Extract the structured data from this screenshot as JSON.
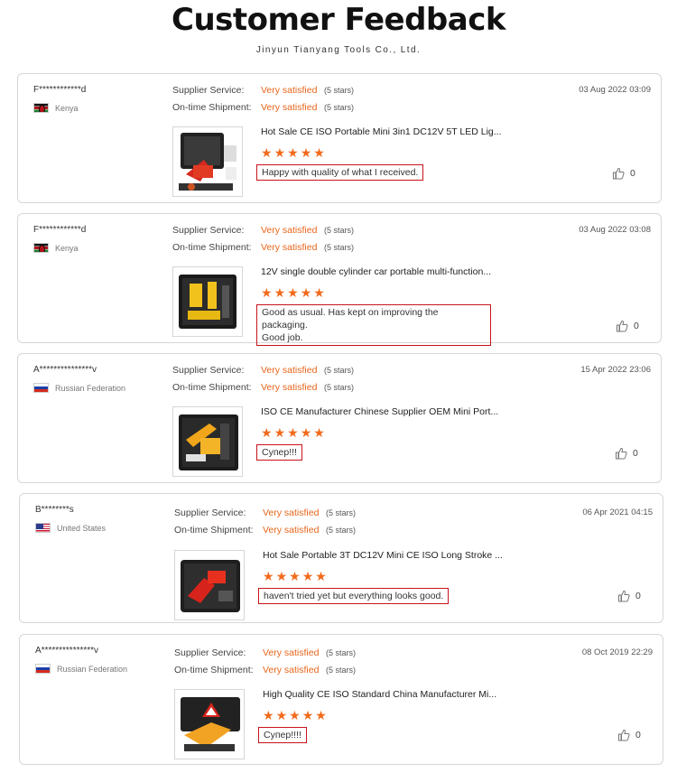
{
  "header": {
    "title": "Customer Feedback",
    "subtitle": "Jinyun Tianyang Tools Co., Ltd."
  },
  "labels": {
    "supplier_service": "Supplier Service:",
    "ontime_shipment": "On-time Shipment:"
  },
  "reviews": [
    {
      "user": "F************d",
      "country": "Kenya",
      "flag": "kenya-flag-icon",
      "date": "03 Aug 2022 03:09",
      "supplier_service": "Very satisfied",
      "supplier_stars": "(5 stars)",
      "shipment": "Very satisfied",
      "shipment_stars": "(5 stars)",
      "product": "Hot Sale CE ISO Portable Mini 3in1 DC12V 5T LED Lig...",
      "rating": 5,
      "comment": [
        "Happy with quality of what I received."
      ],
      "likes": "0"
    },
    {
      "user": "F************d",
      "country": "Kenya",
      "flag": "kenya-flag-icon",
      "date": "03 Aug 2022 03:08",
      "supplier_service": "Very satisfied",
      "supplier_stars": "(5 stars)",
      "shipment": "Very satisfied",
      "shipment_stars": "(5 stars)",
      "product": "12V single double cylinder car portable multi-function...",
      "rating": 5,
      "comment": [
        "Good as usual. Has kept on improving the packaging.",
        "Good job."
      ],
      "likes": "0"
    },
    {
      "user": "A***************v",
      "country": "Russian Federation",
      "flag": "russia-flag-icon",
      "date": "15 Apr 2022 23:06",
      "supplier_service": "Very satisfied",
      "supplier_stars": "(5 stars)",
      "shipment": "Very satisfied",
      "shipment_stars": "(5 stars)",
      "product": "ISO CE Manufacturer Chinese Supplier OEM Mini Port...",
      "rating": 5,
      "comment": [
        "Супер!!!"
      ],
      "likes": "0"
    },
    {
      "user": "B********s",
      "country": "United States",
      "flag": "usa-flag-icon",
      "date": "06 Apr 2021 04:15",
      "supplier_service": "Very satisfied",
      "supplier_stars": "(5 stars)",
      "shipment": "Very satisfied",
      "shipment_stars": "(5 stars)",
      "product": "Hot Sale Portable 3T DC12V Mini CE ISO Long Stroke ...",
      "rating": 5,
      "comment": [
        "haven't tried yet but everything looks good."
      ],
      "likes": "0"
    },
    {
      "user": "A***************v",
      "country": "Russian Federation",
      "flag": "russia-flag-icon",
      "date": "08 Oct 2019 22:29",
      "supplier_service": "Very satisfied",
      "supplier_stars": "(5 stars)",
      "shipment": "Very satisfied",
      "shipment_stars": "(5 stars)",
      "product": "High Quality CE ISO Standard China Manufacturer Mi...",
      "rating": 5,
      "comment": [
        "Супер!!!!"
      ],
      "likes": "0"
    }
  ]
}
